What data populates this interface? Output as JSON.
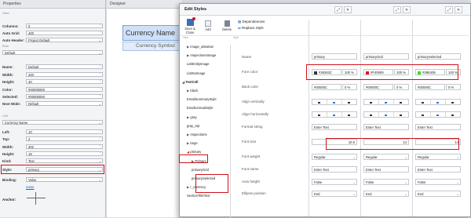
{
  "properties": {
    "title": "Properties",
    "sections": {
      "view": "View",
      "row": "Row",
      "cell": "Cell"
    },
    "view": [
      {
        "label": "Columns:",
        "value": "0"
      },
      {
        "label": "Auto Grid:",
        "value": "400"
      },
      {
        "label": "Auto Header:",
        "value": "Project Default"
      }
    ],
    "row_select": "Default",
    "row": [
      {
        "label": "Name:",
        "value": "Default"
      },
      {
        "label": "Width:",
        "value": "320"
      },
      {
        "label": "Height:",
        "value": "40"
      },
      {
        "label": "Color:",
        "value": "#00000000"
      },
      {
        "label": "Selected:",
        "value": "#00000000"
      },
      {
        "label": "Next Wide:",
        "value": "Default"
      }
    ],
    "cell_select": "Currency Name",
    "cell": [
      {
        "label": "Left:",
        "value": "10"
      },
      {
        "label": "Top:",
        "value": "2"
      },
      {
        "label": "Width:",
        "value": "302"
      },
      {
        "label": "Height:",
        "value": "18"
      },
      {
        "label": "Kind:",
        "value": "Text"
      },
      {
        "label": "Style:",
        "value": "primary"
      },
      {
        "label": "Binding:",
        "value": "Value"
      }
    ],
    "binding_link": "name",
    "anchor_label": "Anchor:"
  },
  "designer": {
    "title": "Designer",
    "cell1": "Currency Name",
    "cell2": "Currency Symbol"
  },
  "dialog": {
    "title": "Edit Styles",
    "toolbar": [
      {
        "label": "Save & Close",
        "icon": "save-icon"
      },
      {
        "label": "Add",
        "icon": "add-icon"
      },
      {
        "label": "Delete",
        "icon": "delete-icon"
      }
    ],
    "dependencies": "Dependencies",
    "replace_style": "Replace Style",
    "tree_header": "View",
    "style_header": "Style",
    "tree": [
      {
        "label": "image_absolute",
        "x": 6,
        "arrow": "▶"
      },
      {
        "label": "InspectionsImage",
        "x": 6,
        "arrow": "▶"
      },
      {
        "label": "ListEntityImage",
        "x": 6,
        "arrow": ""
      },
      {
        "label": "ListNoImage",
        "x": 6,
        "arrow": ""
      },
      {
        "label": "TextCell",
        "x": 0,
        "arrow": "◢",
        "bold": true
      },
      {
        "label": "black",
        "x": 6,
        "arrow": "▶"
      },
      {
        "label": "EmailSummaryStyle",
        "x": 6,
        "arrow": ""
      },
      {
        "label": "EmailUnreadStyle",
        "x": 6,
        "arrow": ""
      },
      {
        "label": "gray",
        "x": 6,
        "arrow": "▶"
      },
      {
        "label": "gray_top",
        "x": 6,
        "arrow": ""
      },
      {
        "label": "Inspections",
        "x": 6,
        "arrow": "▶"
      },
      {
        "label": "large",
        "x": 6,
        "arrow": "▶"
      },
      {
        "label": "primary",
        "x": 6,
        "arrow": "◢"
      },
      {
        "label": "Primary",
        "x": 12,
        "arrow": "▶"
      },
      {
        "label": "primaryGrid",
        "x": 12,
        "arrow": ""
      },
      {
        "label": "primarySelected",
        "x": 12,
        "arrow": ""
      },
      {
        "label": "r_currency",
        "x": 6,
        "arrow": "▶"
      },
      {
        "label": "SectionTitleText",
        "x": 6,
        "arrow": ""
      }
    ],
    "prop_labels": [
      "Name",
      "Fore color",
      "Back color",
      "Align vertically",
      "Align horizontally",
      "Format string",
      "Font size",
      "Font weight",
      "Font name",
      "Auto height",
      "Ellipsis position"
    ],
    "columns": [
      {
        "name": "primary",
        "fore_color": "#36363C",
        "fore_swatch": "#36363c",
        "fore_pct": "100 %",
        "back_color": "#00000C",
        "back_pct": "0 %",
        "format": "Enter Text",
        "font_size": "10.5",
        "weight": "Regular",
        "font_name": "Enter Text",
        "auto_height": "False",
        "ellipsis": "End"
      },
      {
        "name": "primaryGrid",
        "fore_color": "#F40909",
        "fore_swatch": "#f40909",
        "fore_pct": "100 %",
        "back_color": "#00000C",
        "back_pct": "0 %",
        "format": "Enter Text",
        "font_size": "14",
        "weight": "Regular",
        "font_name": "Enter Text",
        "auto_height": "False",
        "ellipsis": "End"
      },
      {
        "name": "primarySelected",
        "fore_color": "#39E405",
        "fore_swatch": "#39e405",
        "fore_pct": "100 %",
        "back_color": "#00000C",
        "back_pct": "0 %",
        "format": "Enter Text",
        "font_size": "14",
        "weight": "Regular",
        "font_name": "Enter Text",
        "auto_height": "False",
        "ellipsis": "End"
      }
    ]
  },
  "colors": {
    "highlight": "#d0121b",
    "selection": "#2a7de1"
  }
}
